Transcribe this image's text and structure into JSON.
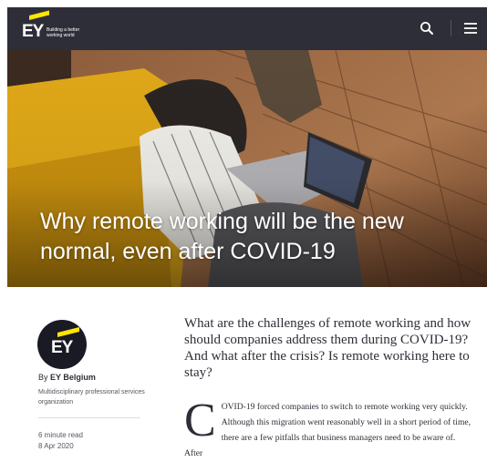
{
  "header": {
    "logo_text": "EY",
    "tagline": "Building a better working world"
  },
  "hero": {
    "title": "Why remote working will be the new normal, even after COVID-19"
  },
  "author": {
    "by_label": "By",
    "name": "EY Belgium",
    "description": "Multidisciplinary professional services organization",
    "read_time": "6 minute read",
    "date": "8 Apr 2020",
    "avatar_text": "EY"
  },
  "article": {
    "intro": "What are the challenges of remote working and how should companies address them during COVID-19? And what after the crisis? Is remote working here to stay?",
    "dropcap": "C",
    "body": "OVID-19 forced companies to switch to remote working very quickly. Although this migration went reasonably well in a short period of time, there are a few pitfalls that business managers need to be aware of. After"
  },
  "colors": {
    "brand_yellow": "#ffe600",
    "header_bg": "#2e2e38"
  }
}
